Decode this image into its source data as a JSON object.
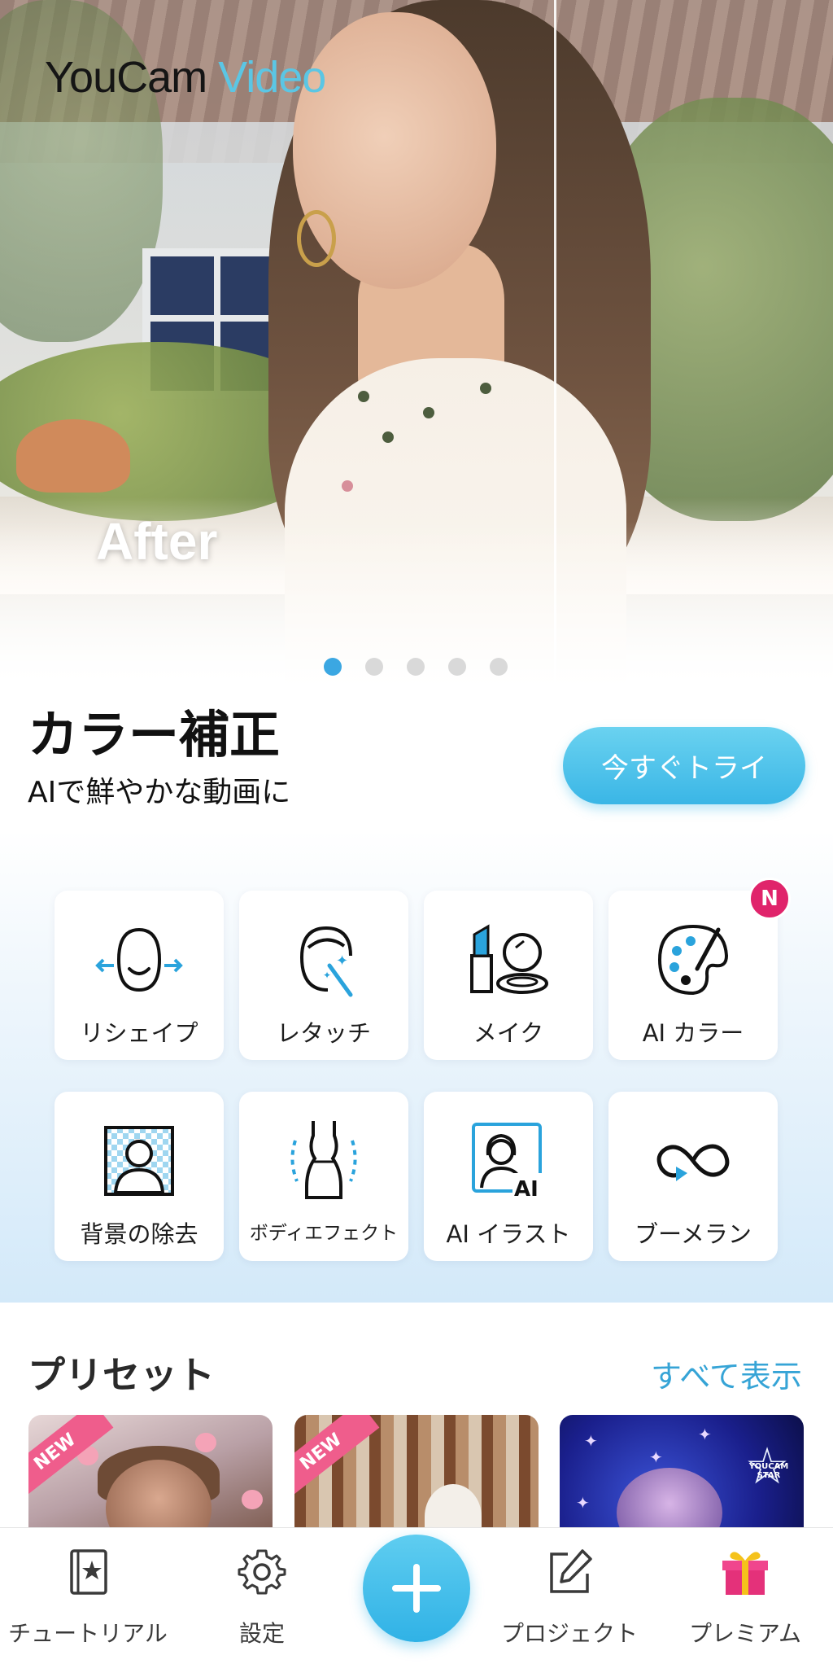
{
  "hero": {
    "brand_part1": "YouCam",
    "brand_part2": "Video",
    "overlay_label": "After",
    "carousel_total": 5,
    "carousel_active": 1
  },
  "feature": {
    "title": "カラー補正",
    "subtitle": "AIで鮮やかな動画に",
    "cta_label": "今すぐトライ"
  },
  "tools": [
    {
      "id": "reshape",
      "label": "リシェイプ",
      "icon": "face-reshape-icon"
    },
    {
      "id": "retouch",
      "label": "レタッチ",
      "icon": "magic-wand-face-icon"
    },
    {
      "id": "makeup",
      "label": "メイク",
      "icon": "lipstick-compact-icon"
    },
    {
      "id": "ai-color",
      "label": "AI カラー",
      "icon": "palette-brush-icon",
      "badge": "N"
    },
    {
      "id": "bg-remove",
      "label": "背景の除去",
      "icon": "background-remove-icon"
    },
    {
      "id": "body-effect",
      "label": "ボディエフェクト",
      "icon": "body-shape-icon"
    },
    {
      "id": "ai-illust",
      "label": "AI イラスト",
      "icon": "ai-portrait-icon",
      "icon_text": "AI"
    },
    {
      "id": "boomerang",
      "label": "ブーメラン",
      "icon": "infinity-loop-icon"
    }
  ],
  "presets": {
    "title": "プリセット",
    "see_all_label": "すべて表示",
    "new_badge": "NEW",
    "star_badge_text": "YOUCAM STAR",
    "items": [
      {
        "name": "preset-1",
        "is_new": true
      },
      {
        "name": "preset-2",
        "is_new": true
      },
      {
        "name": "preset-3",
        "is_new": false
      }
    ]
  },
  "bottom_nav": {
    "tutorial": "チュートリアル",
    "settings": "設定",
    "project": "プロジェクト",
    "premium": "プレミアム"
  },
  "colors": {
    "accent": "#3ab6e6",
    "brand_blue": "#5bc6e4",
    "badge_pink": "#e0246b",
    "new_ribbon": "#ef5d8c",
    "link_blue": "#36a4d6"
  }
}
